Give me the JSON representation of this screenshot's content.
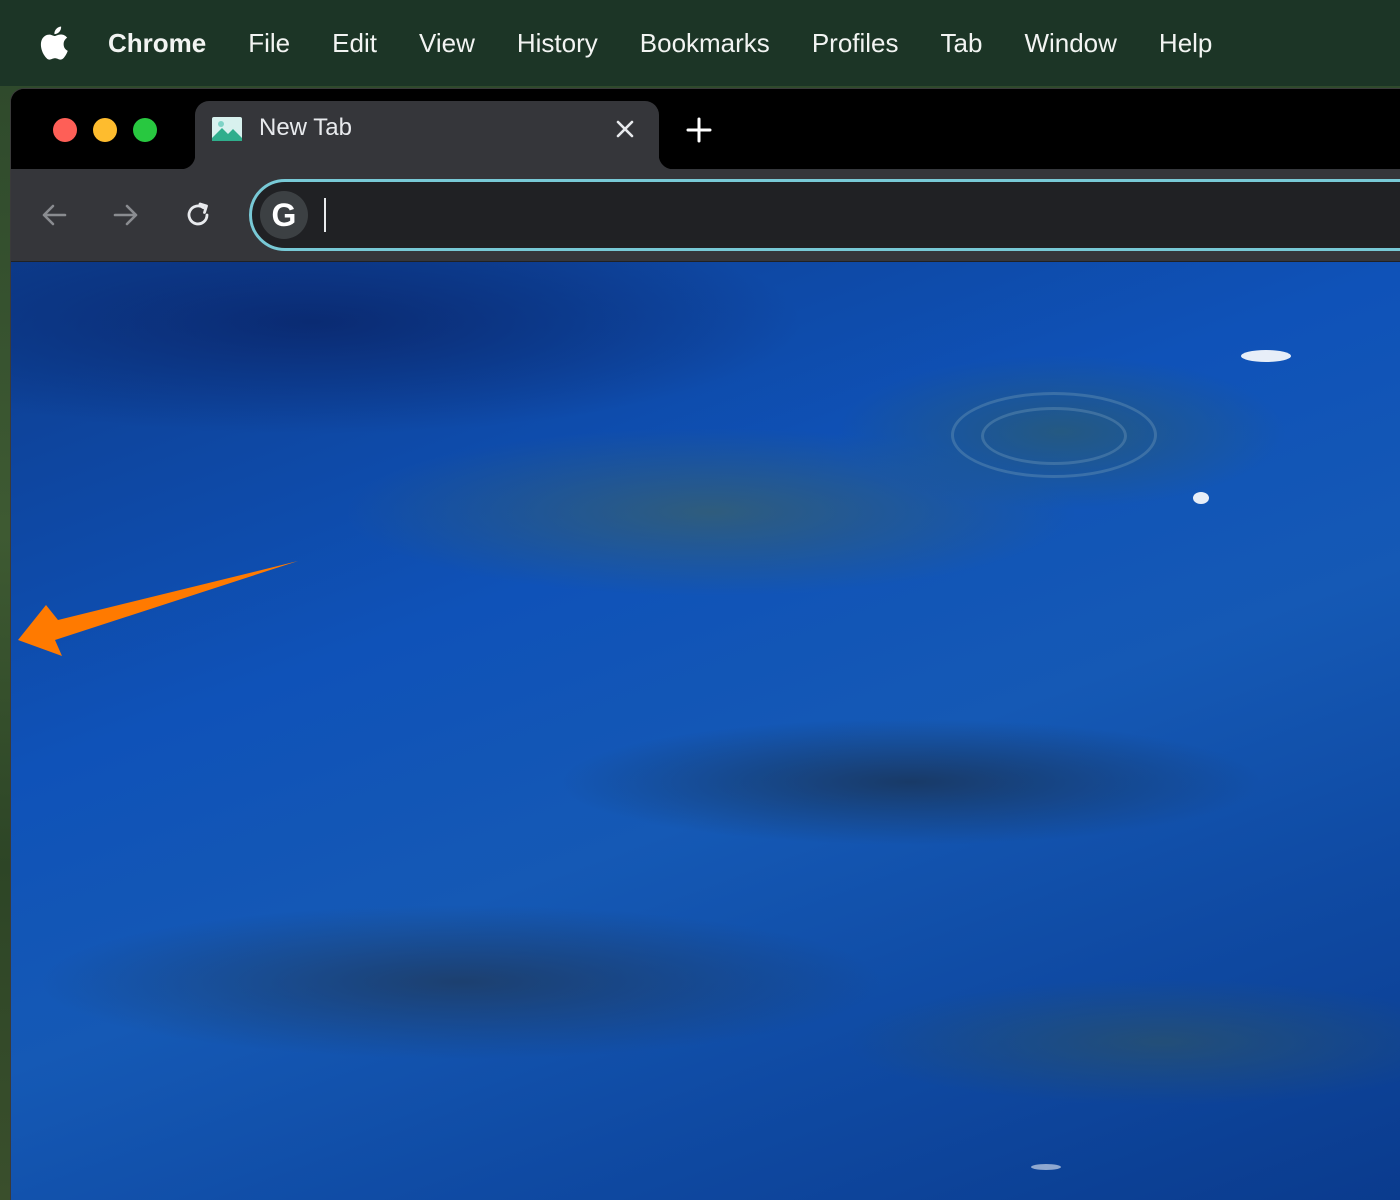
{
  "menubar": {
    "apple_icon": "apple-logo-icon",
    "app_name": "Chrome",
    "items": [
      "File",
      "Edit",
      "View",
      "History",
      "Bookmarks",
      "Profiles",
      "Tab",
      "Window",
      "Help"
    ]
  },
  "window": {
    "traffic_lights": {
      "close_color": "#fe5f57",
      "minimize_color": "#febc2e",
      "zoom_color": "#28c840"
    },
    "tab": {
      "title": "New Tab",
      "favicon": "landscape-image-icon",
      "close_icon": "close-icon"
    },
    "new_tab_icon": "plus-icon",
    "toolbar": {
      "back_icon": "arrow-left-icon",
      "forward_icon": "arrow-right-icon",
      "reload_icon": "reload-icon",
      "omnibox": {
        "search_engine_badge": "G",
        "value": "",
        "focus_color": "#78c9d6"
      }
    }
  },
  "annotation": {
    "type": "arrow",
    "color": "#ff7a00",
    "direction": "left"
  }
}
